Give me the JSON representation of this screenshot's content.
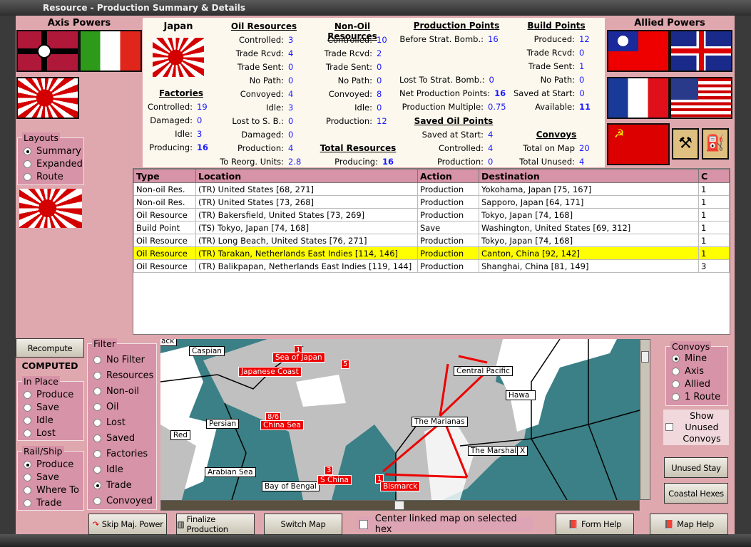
{
  "window": {
    "title": "Resource - Production Summary & Details"
  },
  "axis": {
    "title": "Axis Powers",
    "flags": [
      "germany-flag",
      "italy-flag",
      "japan-flag"
    ]
  },
  "allied": {
    "title": "Allied Powers",
    "flags": [
      "china-flag",
      "uk-flag",
      "france-flag",
      "usa-flag",
      "ussr-flag",
      "resource-icon",
      "oil-icon"
    ]
  },
  "layouts": {
    "title": "Layouts",
    "options": [
      "Summary",
      "Expanded",
      "Route"
    ],
    "selected": "Summary"
  },
  "summary": {
    "country": "Japan",
    "factories": {
      "title": "Factories",
      "rows": [
        {
          "k": "Controlled:",
          "v": "19"
        },
        {
          "k": "Damaged:",
          "v": "0"
        },
        {
          "k": "Idle:",
          "v": "3"
        },
        {
          "k": "Producing:",
          "v": "16"
        }
      ]
    },
    "oil": {
      "title": "Oil Resources",
      "rows": [
        {
          "k": "Controlled:",
          "v": "3"
        },
        {
          "k": "Trade Rcvd:",
          "v": "4"
        },
        {
          "k": "Trade Sent:",
          "v": "0"
        },
        {
          "k": "No Path:",
          "v": "0"
        },
        {
          "k": "Convoyed:",
          "v": "4"
        },
        {
          "k": "Idle:",
          "v": "3"
        },
        {
          "k": "Lost to S. B.:",
          "v": "0"
        },
        {
          "k": "Damaged:",
          "v": "0"
        },
        {
          "k": "Production:",
          "v": "4"
        },
        {
          "k": "To Reorg. Units:",
          "v": "2.8"
        }
      ]
    },
    "nonoil": {
      "title": "Non-Oil Resources",
      "rows": [
        {
          "k": "Controlled:",
          "v": "10"
        },
        {
          "k": "Trade Rcvd:",
          "v": "2"
        },
        {
          "k": "Trade Sent:",
          "v": "0"
        },
        {
          "k": "No Path:",
          "v": "0"
        },
        {
          "k": "Convoyed:",
          "v": "8"
        },
        {
          "k": "Idle:",
          "v": "0"
        },
        {
          "k": "Production:",
          "v": "12"
        }
      ]
    },
    "total": {
      "title": "Total Resources",
      "rows": [
        {
          "k": "Producing:",
          "v": "16"
        }
      ]
    },
    "pp": {
      "title": "Production Points",
      "rows": [
        {
          "k": "Before Strat. Bomb.:",
          "v": "16"
        },
        {
          "k": "Lost To Strat. Bomb.:",
          "v": "0"
        },
        {
          "k": "Net Production Points:",
          "v": "16"
        },
        {
          "k": "Production Multiple:",
          "v": "0.75"
        }
      ]
    },
    "savedoil": {
      "title": "Saved Oil Points",
      "rows": [
        {
          "k": "Saved at Start:",
          "v": "4"
        },
        {
          "k": "Controlled:",
          "v": "4"
        },
        {
          "k": "Production:",
          "v": "0"
        }
      ]
    },
    "bp": {
      "title": "Build Points",
      "rows": [
        {
          "k": "Produced:",
          "v": "12"
        },
        {
          "k": "Trade Rcvd:",
          "v": "0"
        },
        {
          "k": "Trade Sent:",
          "v": "1"
        },
        {
          "k": "No Path:",
          "v": "0"
        },
        {
          "k": "Saved at Start:",
          "v": "0"
        },
        {
          "k": "Available:",
          "v": "11"
        }
      ]
    },
    "convoys": {
      "title": "Convoys",
      "rows": [
        {
          "k": "Total on Map",
          "v": "20"
        },
        {
          "k": "Total Unused:",
          "v": "4"
        }
      ]
    }
  },
  "table": {
    "columns": [
      "Type",
      "Location",
      "Action",
      "Destination",
      "C"
    ],
    "rows": [
      [
        "Non-oil Res.",
        "(TR) United States [68, 271]",
        "Production",
        "Yokohama, Japan [75, 167]",
        "1"
      ],
      [
        "Non-oil Res.",
        "(TR) United States [73, 268]",
        "Production",
        "Sapporo, Japan [64, 171]",
        "1"
      ],
      [
        "Oil Resource",
        "(TR) Bakersfield, United States [73, 269]",
        "Production",
        "Tokyo, Japan [74, 168]",
        "1"
      ],
      [
        "Build Point",
        "(TS) Tokyo, Japan [74, 168]",
        "Save",
        "Washington, United States [69, 312]",
        "1"
      ],
      [
        "Oil Resource",
        "(TR) Long Beach, United States [76, 271]",
        "Production",
        "Tokyo, Japan [74, 168]",
        "1"
      ],
      [
        "Oil Resource",
        "(TR) Tarakan, Netherlands East Indies [114, 146]",
        "Production",
        "Canton, China [92, 142]",
        "1"
      ],
      [
        "Oil Resource",
        "(TR) Balikpapan, Netherlands East Indies [119, 144]",
        "Production",
        "Shanghai, China [81, 149]",
        "3"
      ]
    ],
    "selected_index": 5
  },
  "left": {
    "recompute": "Recompute",
    "status": "COMPUTED",
    "inplace": {
      "title": "In Place",
      "options": [
        "Produce",
        "Save",
        "Idle",
        "Lost"
      ]
    },
    "railship": {
      "title": "Rail/Ship",
      "options": [
        "Produce",
        "Save",
        "Where To",
        "Trade"
      ],
      "selected": "Produce"
    }
  },
  "filter": {
    "title": "Filter",
    "options": [
      "No Filter",
      "Resources",
      "Non-oil",
      "Oil",
      "Lost",
      "Saved",
      "Factories",
      "Idle",
      "Trade",
      "Convoyed"
    ],
    "selected": "Trade"
  },
  "map": {
    "labels": [
      "ack",
      "Caspian",
      "Persian",
      "Red",
      "Arabian Sea",
      "Bay of Bengal",
      "Central Pacific",
      "Hawa",
      "The Marianas",
      "The Marshalls",
      "X"
    ],
    "route": [
      {
        "name": "Sea of Japan",
        "n": "1"
      },
      {
        "name": "Japanese Coast",
        "n": "5"
      },
      {
        "name": "China Sea",
        "n": "8/6"
      },
      {
        "name": "S China",
        "n": "3"
      },
      {
        "name": "Bismarck",
        "n": "1"
      }
    ],
    "colors": {
      "sea": "#3a8086",
      "land": "#c0c0c0",
      "route": "#e00000"
    }
  },
  "convoys": {
    "title": "Convoys",
    "options": [
      "Mine",
      "Axis",
      "Allied",
      "1 Route"
    ],
    "selected": "Mine",
    "show_unused": "Show Unused Convoys",
    "unused_stay": "Unused Stay",
    "coastal_hexes": "Coastal Hexes"
  },
  "bottom": {
    "skip": "Skip Maj. Power",
    "finalize": "Finalize Production",
    "switch": "Switch Map",
    "center": "Center linked map on selected hex",
    "form_help": "Form Help",
    "map_help": "Map Help"
  }
}
